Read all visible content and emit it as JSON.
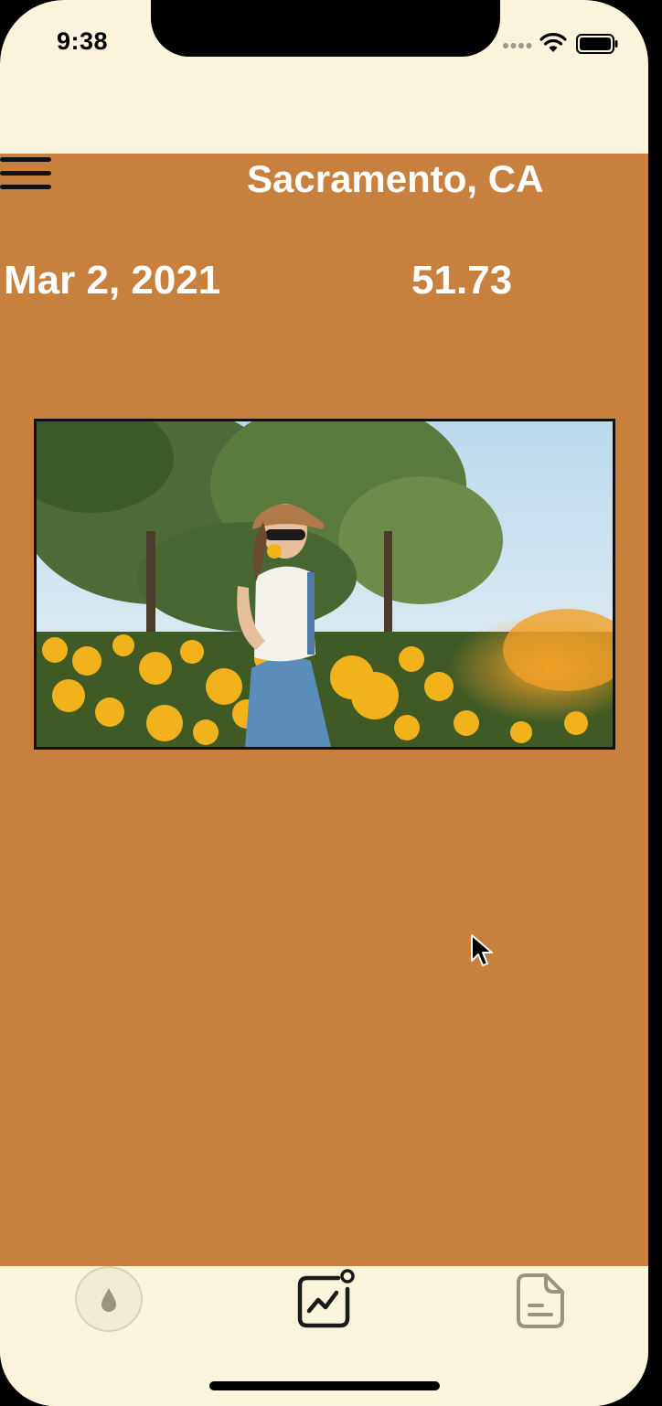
{
  "status_bar": {
    "time": "9:38",
    "icons": [
      "cellular-signal-icon",
      "wifi-icon",
      "battery-icon"
    ]
  },
  "header": {
    "menu_icon": "hamburger-menu-icon",
    "location": "Sacramento, CA"
  },
  "reading": {
    "date": "Mar 2, 2021",
    "value": "51.73"
  },
  "photo": {
    "description_icon": "photo"
  },
  "tab_bar": {
    "tabs": [
      {
        "icon": "water-drop-icon"
      },
      {
        "icon": "chart-icon"
      },
      {
        "icon": "document-icon"
      }
    ]
  },
  "colors": {
    "background_accent": "#c8803f",
    "cream": "#fbf4dd",
    "text": "#ffffff"
  }
}
